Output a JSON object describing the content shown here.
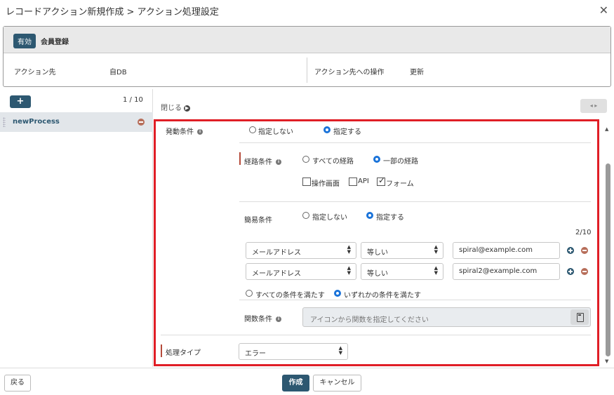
{
  "window": {
    "title": "レコードアクション新規作成 > アクション処理設定",
    "close_icon": "close-icon"
  },
  "record": {
    "status_badge": "有効",
    "name": "会員登録",
    "action_target_label": "アクション先",
    "action_target_value": "自DB",
    "operation_label": "アクション先への操作",
    "operation_value": "更新"
  },
  "process_list": {
    "add_label": "+",
    "pager": "1 / 10",
    "items": [
      {
        "label": "newProcess"
      }
    ]
  },
  "detail": {
    "close_label": "閉じる",
    "nav_label": "◂ ▸",
    "trigger": {
      "label": "発動条件",
      "options": [
        "指定しない",
        "指定する"
      ],
      "selected": 1
    },
    "route": {
      "label": "経路条件",
      "options": [
        "すべての経路",
        "一部の経路"
      ],
      "selected": 1,
      "checks": [
        {
          "label": "操作画面",
          "checked": false
        },
        {
          "label": "API",
          "checked": false
        },
        {
          "label": "フォーム",
          "checked": true
        }
      ]
    },
    "simple": {
      "label": "簡易条件",
      "options": [
        "指定しない",
        "指定する"
      ],
      "selected": 1,
      "count": "2/10",
      "rows": [
        {
          "field": "メールアドレス",
          "op": "等しい",
          "value": "spiral@example.com"
        },
        {
          "field": "メールアドレス",
          "op": "等しい",
          "value": "spiral2@example.com"
        }
      ],
      "match_options": [
        "すべての条件を満たす",
        "いずれかの条件を満たす"
      ],
      "match_selected": 1
    },
    "function": {
      "label": "関数条件",
      "placeholder": "アイコンから関数を指定してください"
    },
    "process_type": {
      "label": "処理タイプ",
      "value": "エラー"
    }
  },
  "footer": {
    "back": "戻る",
    "create": "作成",
    "cancel": "キャンセル"
  }
}
